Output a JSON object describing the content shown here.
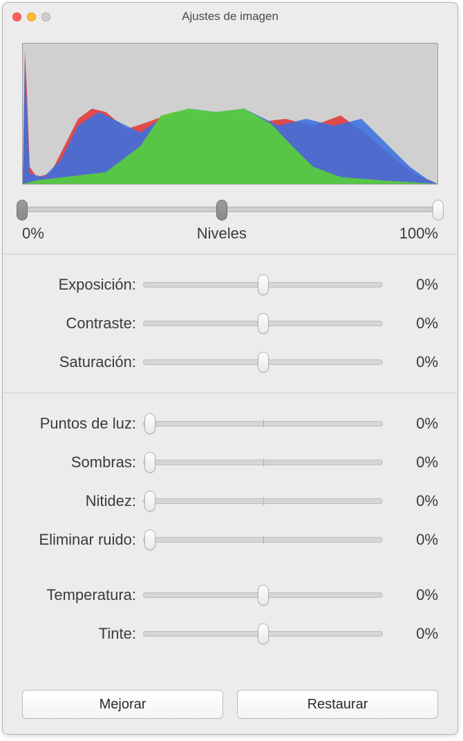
{
  "window": {
    "title": "Ajustes de imagen"
  },
  "levels": {
    "leftLabel": "0%",
    "centerLabel": "Niveles",
    "rightLabel": "100%",
    "thumbs": {
      "black": 0,
      "mid": 48,
      "white": 100
    }
  },
  "sliders": {
    "group1": [
      {
        "id": "exposure",
        "label": "Exposición:",
        "thumb": 50,
        "value": "0%"
      },
      {
        "id": "contrast",
        "label": "Contraste:",
        "thumb": 50,
        "value": "0%"
      },
      {
        "id": "saturation",
        "label": "Saturación:",
        "thumb": 50,
        "value": "0%"
      }
    ],
    "group2": [
      {
        "id": "highlights",
        "label": "Puntos de luz:",
        "thumb": 3,
        "value": "0%"
      },
      {
        "id": "shadows",
        "label": "Sombras:",
        "thumb": 3,
        "value": "0%"
      },
      {
        "id": "sharpness",
        "label": "Nitidez:",
        "thumb": 3,
        "value": "0%"
      },
      {
        "id": "denoise",
        "label": "Eliminar ruido:",
        "thumb": 3,
        "value": "0%"
      }
    ],
    "group3": [
      {
        "id": "temperature",
        "label": "Temperatura:",
        "thumb": 50,
        "value": "0%"
      },
      {
        "id": "tint",
        "label": "Tinte:",
        "thumb": 50,
        "value": "0%"
      }
    ]
  },
  "buttons": {
    "enhance": "Mejorar",
    "restore": "Restaurar"
  }
}
